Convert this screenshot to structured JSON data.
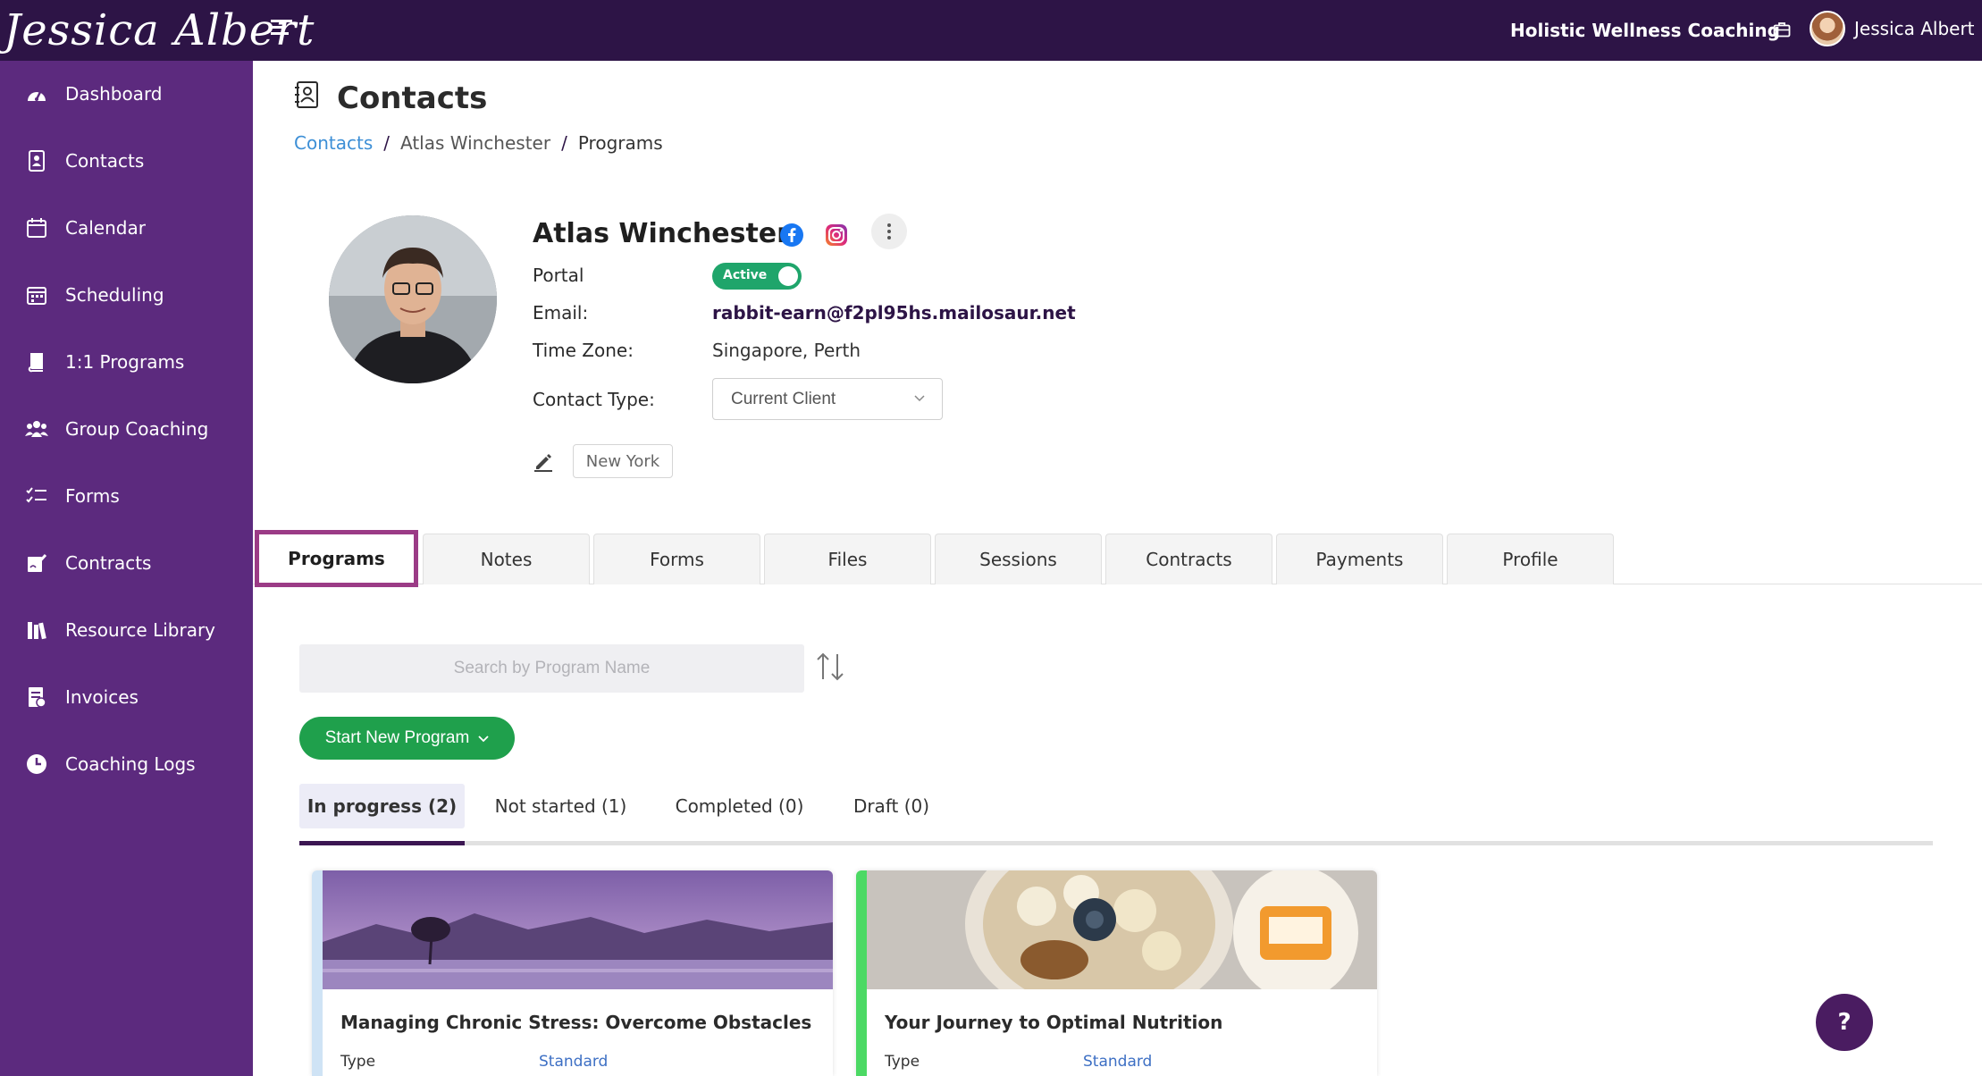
{
  "header": {
    "logo_text": "Jessica Albert",
    "business_name": "Holistic Wellness Coaching",
    "user_name": "Jessica Albert"
  },
  "sidebar": {
    "items": [
      {
        "label": "Dashboard",
        "icon": "dashboard-icon"
      },
      {
        "label": "Contacts",
        "icon": "contacts-icon"
      },
      {
        "label": "Calendar",
        "icon": "calendar-icon"
      },
      {
        "label": "Scheduling",
        "icon": "scheduling-icon"
      },
      {
        "label": "1:1 Programs",
        "icon": "book-icon"
      },
      {
        "label": "Group Coaching",
        "icon": "group-icon"
      },
      {
        "label": "Forms",
        "icon": "list-check-icon"
      },
      {
        "label": "Contracts",
        "icon": "signature-icon"
      },
      {
        "label": "Resource Library",
        "icon": "library-icon"
      },
      {
        "label": "Invoices",
        "icon": "invoice-icon"
      },
      {
        "label": "Coaching Logs",
        "icon": "clock-icon"
      }
    ]
  },
  "page": {
    "title": "Contacts",
    "breadcrumb": [
      "Contacts",
      "Atlas Winchester",
      "Programs"
    ]
  },
  "contact": {
    "name": "Atlas Winchester",
    "portal_label": "Portal",
    "portal_status": "Active",
    "email_label": "Email:",
    "email": "rabbit-earn@f2pl95hs.mailosaur.net",
    "timezone_label": "Time Zone:",
    "timezone": "Singapore, Perth",
    "contact_type_label": "Contact Type:",
    "contact_type": "Current Client",
    "tag": "New York"
  },
  "tabs": [
    "Programs",
    "Notes",
    "Forms",
    "Files",
    "Sessions",
    "Contracts",
    "Payments",
    "Profile"
  ],
  "active_tab": "Programs",
  "programs": {
    "search_placeholder": "Search by Program Name",
    "start_button": "Start New Program",
    "status_tabs": [
      "In progress (2)",
      "Not started (1)",
      "Completed (0)",
      "Draft (0)"
    ],
    "cards": [
      {
        "title": "Managing Chronic Stress: Overcome Obstacles",
        "type_label": "Type",
        "type_value": "Standard",
        "accent": "#cfe3f5"
      },
      {
        "title": "Your Journey to Optimal Nutrition",
        "type_label": "Type",
        "type_value": "Standard",
        "accent": "#4cd964"
      }
    ]
  },
  "help_label": "?",
  "colors": {
    "topbar": "#2d1446",
    "sidebar": "#5c2a7e",
    "active_tab_border": "#9b3b86",
    "primary_green": "#1fa04c",
    "link_blue": "#3d8fd6"
  }
}
